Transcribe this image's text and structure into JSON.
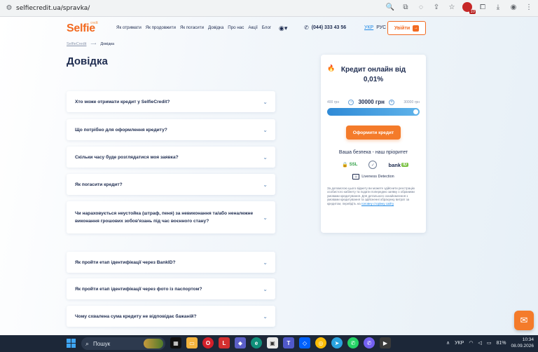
{
  "browser": {
    "url": "selfiecredit.ua/spravka/",
    "extension_badge": "10"
  },
  "header": {
    "logo": "Selfie",
    "logo_tag": "credit",
    "nav": [
      "Як отримати",
      "Як продовжити",
      "Як погасити",
      "Довідка",
      "Про нас",
      "Акції",
      "Блог"
    ],
    "phone": "(044) 333 43 56",
    "lang_active": "УКР",
    "lang_other": "РУС",
    "login_label": "Увійти"
  },
  "breadcrumb": {
    "home": "SelfieCredit",
    "separator": "⟶",
    "current": "Довідка"
  },
  "page_title": "Довідка",
  "faq": [
    {
      "q": "Хто може отримати кредит у SelfieCredit?"
    },
    {
      "q": "Що потрібно для оформлення кредиту?"
    },
    {
      "q": "Скільки часу буде розглядатися моя заявка?"
    },
    {
      "q": "Як погасити кредит?"
    },
    {
      "q": "Чи нараховується неустойка (штраф, пеня) за невиконання та/або неналежне виконання грошових зобов'язань під час воєнного стану?"
    },
    {
      "q": "Як пройти етап ідентифікації через BankID?"
    },
    {
      "q": "Як пройти етап ідентифікації через фото із паспортом?"
    },
    {
      "q": "Чому схвалена сума кредиту не відповідає бажаній?"
    }
  ],
  "calculator": {
    "title_line1": "Кредит онлайн від",
    "title_line2": "0,01%",
    "min": "400 грн",
    "amount": "30000 грн",
    "max": "30000 грн",
    "slider_fraction": 1.0,
    "cta": "Оформити кредит",
    "security_title": "Ваша безпека - наш пріоритет",
    "ssl": "SSL",
    "bankid": "bank",
    "bankid_tag": "ID",
    "liveness": "Liveness Detection",
    "fine_text": "За допомогою цього віджету ви можете здійснити реєстрацію особистого кабінету та подати попередню заявку з обраними умовами кредитування. Для детального ознайомлення з умовами кредитування та здійсненні обрахунку витрат за кредитом, перейдіть на",
    "fine_link": "головну сторінку сайту"
  },
  "taskbar": {
    "search_placeholder": "Пошук",
    "tray_lang": "УКР",
    "battery": "81%",
    "time": "10:34",
    "date": "08.09.2026",
    "telegram_badge": "2"
  },
  "colors": {
    "brand_orange": "#f26a21",
    "primary_blue": "#2f8ad6",
    "text_dark": "#1d2b4f"
  }
}
